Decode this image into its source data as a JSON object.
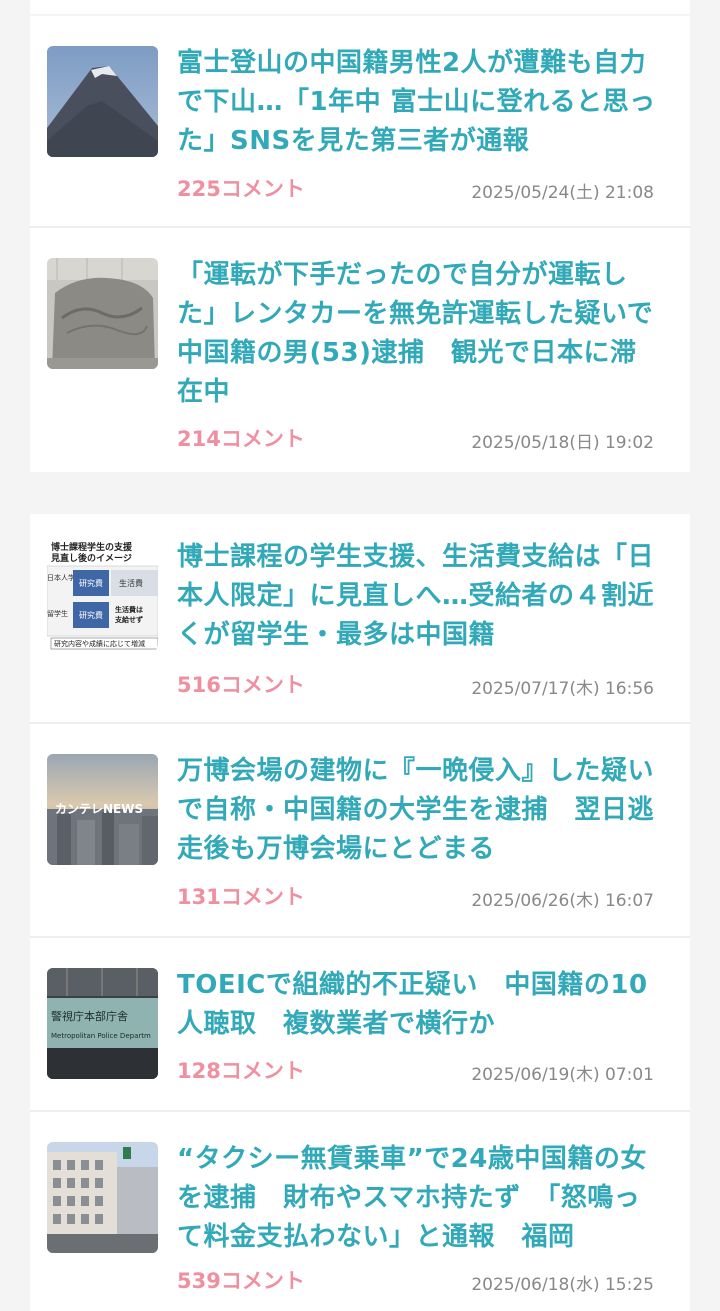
{
  "articles_group_a": [
    {
      "title": "富士登山の中国籍男性2人が遭難も自力で下山…「1年中 富士山に登れると思った」SNSを見た第三者が通報",
      "comments": "225コメント",
      "date": "2025/05/24(土) 21:08",
      "thumb_icon": "mount-fuji-photo"
    },
    {
      "title": "「運転が下手だったので自分が運転した」レンタカーを無免許運転した疑いで中国籍の男(53)逮捕　観光で日本に滞在中",
      "comments": "214コメント",
      "date": "2025/05/18(日) 19:02",
      "thumb_icon": "stone-monument-photo"
    }
  ],
  "articles_group_b": [
    {
      "title": "博士課程の学生支援、生活費支給は「日本人限定」に見直しへ…受給者の４割近くが留学生・最多は中国籍",
      "comments": "516コメント",
      "date": "2025/07/17(木) 16:56",
      "thumb_icon": "support-diagram-graphic",
      "thumb_text": {
        "heading1": "博士課程学生の支援",
        "heading2": "見直し後のイメージ",
        "row1": "日本人学生",
        "row2": "留学生",
        "box1": "研究費",
        "box2": "研究費",
        "box3": "生活費",
        "box4a": "生活費は",
        "box4b": "支給せず",
        "footer": "研究内容や成績に応じて増減"
      }
    },
    {
      "title": "万博会場の建物に『一晩侵入』した疑いで自称・中国籍の大学生を逮捕　翌日逃走後も万博会場にとどまる",
      "comments": "131コメント",
      "date": "2025/06/26(木) 16:07",
      "thumb_icon": "city-skyline-photo",
      "thumb_text": {
        "logo": "カンテレNEWS"
      }
    },
    {
      "title": "TOEICで組織的不正疑い　中国籍の10人聴取　複数業者で横行か",
      "comments": "128コメント",
      "date": "2025/06/19(木) 07:01",
      "thumb_icon": "police-hq-sign-photo",
      "thumb_text": {
        "sign_jp": "警視庁本部庁舎",
        "sign_en": "Metropolitan Police Departm"
      }
    },
    {
      "title": "“タクシー無賃乗車”で24歳中国籍の女を逮捕　財布やスマホ持たず　「怒鳴って料金支払わない」と通報　福岡",
      "comments": "539コメント",
      "date": "2025/06/18(水) 15:25",
      "thumb_icon": "office-building-photo"
    }
  ],
  "colors": {
    "title": "#31a9b8",
    "comments": "#ef8fa0",
    "date": "#888888",
    "background": "#f4f4f4",
    "card": "#ffffff"
  }
}
